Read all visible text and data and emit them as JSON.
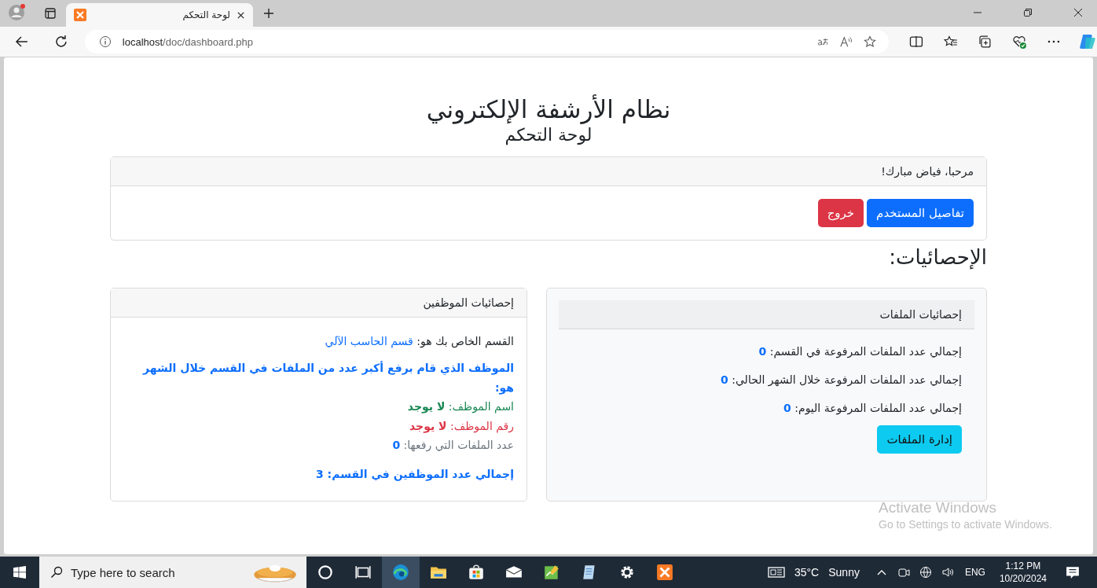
{
  "browser": {
    "tab_title": "لوحة التحكم",
    "address_host": "localhost",
    "address_path": "/doc/dashboard.php"
  },
  "page": {
    "title": "نظام الأرشفة الإلكتروني",
    "subtitle": "لوحة التحكم",
    "welcome": "مرحبا، فياض مبارك!",
    "buttons": [
      {
        "label": "تفاصيل المستخدم",
        "kind": "primary"
      },
      {
        "label": "خروج",
        "kind": "danger"
      }
    ],
    "stats_heading": "الإحصائيات:",
    "files_card": {
      "title": "إحصائيات الملفات",
      "rows": [
        {
          "label": "إجمالي عدد الملفات المرفوعة في القسم:",
          "value": "0"
        },
        {
          "label": "إجمالي عدد الملفات المرفوعة خلال الشهر الحالي:",
          "value": "0"
        },
        {
          "label": "إجمالي عدد الملفات المرفوعة اليوم:",
          "value": "0"
        }
      ],
      "button": "إدارة الملفات"
    },
    "employees_card": {
      "title": "إحصائيات الموظفين",
      "department_label": "القسم الخاص بك هو:",
      "department_value": "قسم الحاسب الآلي",
      "top_heading": "الموظف الذي قام برفع أكبر عدد من الملفات في القسم خلال الشهر هو:",
      "lines": [
        {
          "label": "اسم الموظف:",
          "value": "لا يوجد",
          "kind": "success"
        },
        {
          "label": "رقم الموظف:",
          "value": "لا يوجد",
          "kind": "danger"
        },
        {
          "label": "عدد الملفات التي رفعها:",
          "value": "0",
          "kind": "secondary"
        }
      ],
      "total_label": "إجمالي عدد الموظفين في القسم:",
      "total_value": "3"
    }
  },
  "activation": {
    "title": "Activate Windows",
    "subtitle": "Go to Settings to activate Windows."
  },
  "taskbar": {
    "search_placeholder": "Type here to search",
    "apps": [
      {
        "kind": "cortana",
        "selected": false
      },
      {
        "kind": "taskview",
        "selected": false
      },
      {
        "kind": "edge",
        "selected": true
      },
      {
        "kind": "explorer",
        "selected": false
      },
      {
        "kind": "store",
        "selected": false
      },
      {
        "kind": "mail",
        "selected": false
      },
      {
        "kind": "chart",
        "selected": false
      },
      {
        "kind": "notepad",
        "selected": false
      },
      {
        "kind": "gear",
        "selected": false
      },
      {
        "kind": "xampp",
        "selected": false
      }
    ],
    "temperature": "35°C",
    "weather": "Sunny",
    "language": "ENG",
    "time": "1:12 PM",
    "date": "10/20/2024"
  }
}
